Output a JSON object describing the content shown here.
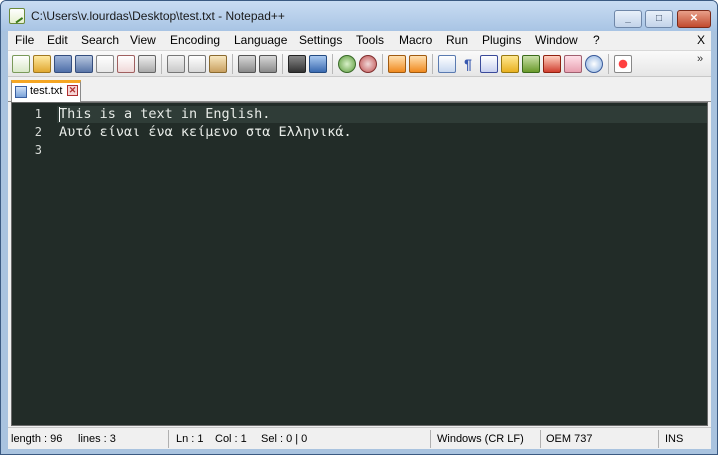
{
  "window": {
    "title": "C:\\Users\\v.lourdas\\Desktop\\test.txt - Notepad++",
    "min": "_",
    "max": "□",
    "close": "✕"
  },
  "menu": [
    "File",
    "Edit",
    "Search",
    "View",
    "Encoding",
    "Language",
    "Settings",
    "Tools",
    "Macro",
    "Run",
    "Plugins",
    "Window",
    "?"
  ],
  "menu_close": "X",
  "toolbar": {
    "icons": [
      "new-file-icon",
      "open-file-icon",
      "save-icon",
      "save-all-icon",
      "close-icon",
      "close-all-icon",
      "print-icon",
      "cut-icon",
      "copy-icon",
      "paste-icon",
      "undo-icon",
      "redo-icon",
      "find-icon",
      "replace-icon",
      "zoom-in-icon",
      "zoom-out-icon",
      "sync-vertical-icon",
      "sync-horizontal-icon",
      "word-wrap-icon",
      "show-all-chars-icon",
      "indent-guide-icon",
      "user-lang-icon",
      "doc-map-icon",
      "function-list-icon",
      "folder-as-workspace-icon",
      "monitoring-icon",
      "record-macro-icon"
    ],
    "overflow": "»"
  },
  "tab": {
    "label": "test.txt",
    "close": "✕"
  },
  "editor": {
    "lines": [
      {
        "num": "1",
        "text": "This is a text in English."
      },
      {
        "num": "2",
        "text": "Αυτό είναι ένα κείμενο στα Ελληνικά."
      },
      {
        "num": "3",
        "text": ""
      }
    ]
  },
  "status": {
    "length": "length : 96",
    "lines": "lines : 3",
    "ln": "Ln : 1",
    "col": "Col : 1",
    "sel": "Sel : 0 | 0",
    "eol": "Windows (CR LF)",
    "encoding": "OEM 737",
    "mode": "INS"
  },
  "colors": {
    "editor_bg": "#222c28",
    "current_line": "#2f3c37",
    "tab_accent": "#f5a623"
  }
}
